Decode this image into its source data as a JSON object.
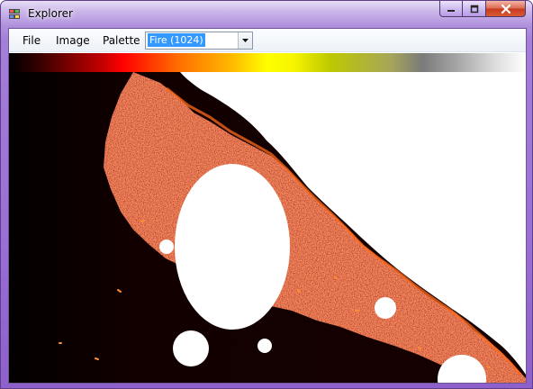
{
  "window": {
    "title": "Explorer",
    "colors": {
      "frame": "#9a6fd6",
      "close_button": "#c8391e",
      "fractal_interior": "#ffffff",
      "fractal_exterior": "#110000"
    }
  },
  "menu": {
    "items": [
      "File",
      "Image",
      "Palette"
    ]
  },
  "palette_select": {
    "value": "Fire (1024)"
  },
  "palette_strip": {
    "colors": [
      "#000000",
      "#670000",
      "#ff0000",
      "#ff7000",
      "#ffff00",
      "#a5a55b",
      "#7a7a7a",
      "#ffffff"
    ]
  },
  "icons": {
    "app": "app-window-icon",
    "minimize": "minimize-icon",
    "maximize": "maximize-icon",
    "close": "close-icon",
    "dropdown": "chevron-down-icon"
  }
}
